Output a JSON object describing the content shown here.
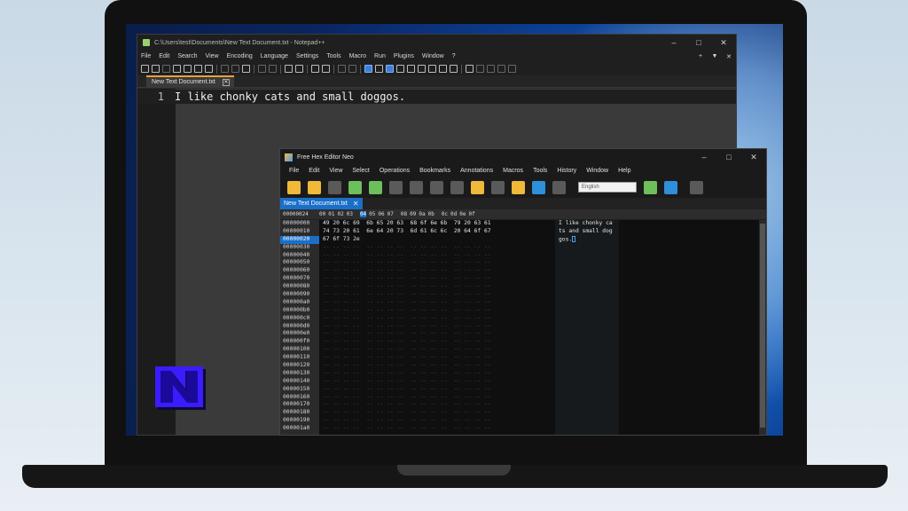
{
  "notepad": {
    "title": "C:\\Users\\test\\Documents\\New Text Document.txt - Notepad++",
    "menu": [
      "File",
      "Edit",
      "Search",
      "View",
      "Encoding",
      "Language",
      "Settings",
      "Tools",
      "Macro",
      "Run",
      "Plugins",
      "Window",
      "?"
    ],
    "menu_right": [
      "+",
      "▼",
      "✕"
    ],
    "tab_label": "New Text Document.txt",
    "line_number": "1",
    "line_text": "I like chonky cats and small doggos."
  },
  "window_controls": {
    "minimize": "–",
    "maximize": "□",
    "close": "✕"
  },
  "hex_editor": {
    "title": "Free Hex Editor Neo",
    "menu": [
      "File",
      "Edit",
      "View",
      "Select",
      "Operations",
      "Bookmarks",
      "Annotations",
      "Macros",
      "Tools",
      "History",
      "Window",
      "Help"
    ],
    "language": "English",
    "tab_label": "New Text Document.txt",
    "header_offset": "00000024",
    "columns": [
      "00",
      "01",
      "02",
      "03",
      "04",
      "05",
      "06",
      "07",
      "08",
      "09",
      "0a",
      "0b",
      "0c",
      "0d",
      "0e",
      "0f"
    ],
    "selected_column": "04",
    "offsets": [
      "00000000",
      "00000010",
      "00000020",
      "00000030",
      "00000040",
      "00000050",
      "00000060",
      "00000070",
      "00000080",
      "00000090",
      "000000a0",
      "000000b0",
      "000000c0",
      "000000d0",
      "000000e0",
      "000000f0",
      "00000100",
      "00000110",
      "00000120",
      "00000130",
      "00000140",
      "00000150",
      "00000160",
      "00000170",
      "00000180",
      "00000190",
      "000001a0"
    ],
    "selected_offset": "00000020",
    "byte_rows": [
      "49 20 6c 69  6b 65 20 63  68 6f 6e 6b  79 20 63 61",
      "74 73 20 61  6e 64 20 73  6d 61 6c 6c  20 64 6f 67",
      "67 6f 73 2e"
    ],
    "ascii_rows": [
      "I like chonky ca",
      "ts and small dog",
      "gos."
    ]
  },
  "logo": {
    "letter": "N",
    "color": "#3b1cff"
  }
}
